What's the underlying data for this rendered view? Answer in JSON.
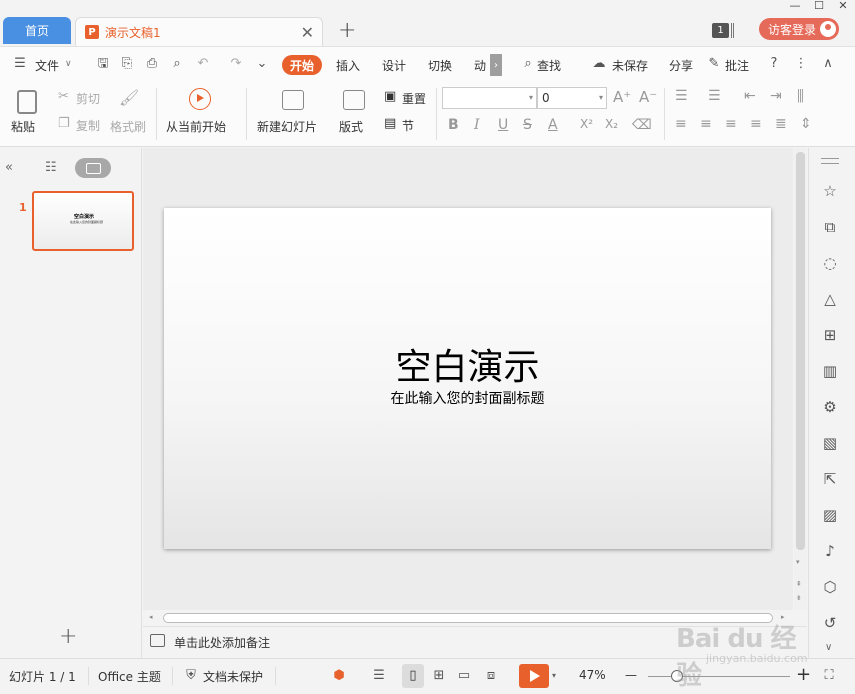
{
  "tabs": {
    "home": "首页",
    "document": "演示文稿1"
  },
  "header": {
    "badge": "1",
    "guest_login": "访客登录"
  },
  "menu": {
    "file": "文件",
    "start": "开始",
    "insert": "插入",
    "design": "设计",
    "transition": "切换",
    "animation": "动",
    "find": "查找",
    "unsaved": "未保存",
    "share": "分享",
    "comment": "批注"
  },
  "ribbon": {
    "paste": "粘贴",
    "cut": "剪切",
    "copy": "复制",
    "format_painter": "格式刷",
    "from_current": "从当前开始",
    "new_slide": "新建幻灯片",
    "layout": "版式",
    "reset": "重置",
    "section": "节",
    "font_size": "0"
  },
  "slide": {
    "number": "1",
    "title": "空白演示",
    "subtitle": "在此输入您的封面副标题"
  },
  "notes": {
    "placeholder": "单击此处添加备注"
  },
  "status": {
    "slide_count": "幻灯片 1 / 1",
    "theme": "Office 主题",
    "protection": "文档未保护",
    "zoom": "47%"
  },
  "watermark": {
    "text": "Bai du 经验",
    "sub": "jingyan.baidu.com"
  },
  "colors": {
    "accent": "#e8612c",
    "home_tab": "#4a90e2",
    "guest": "#e66a5a"
  }
}
